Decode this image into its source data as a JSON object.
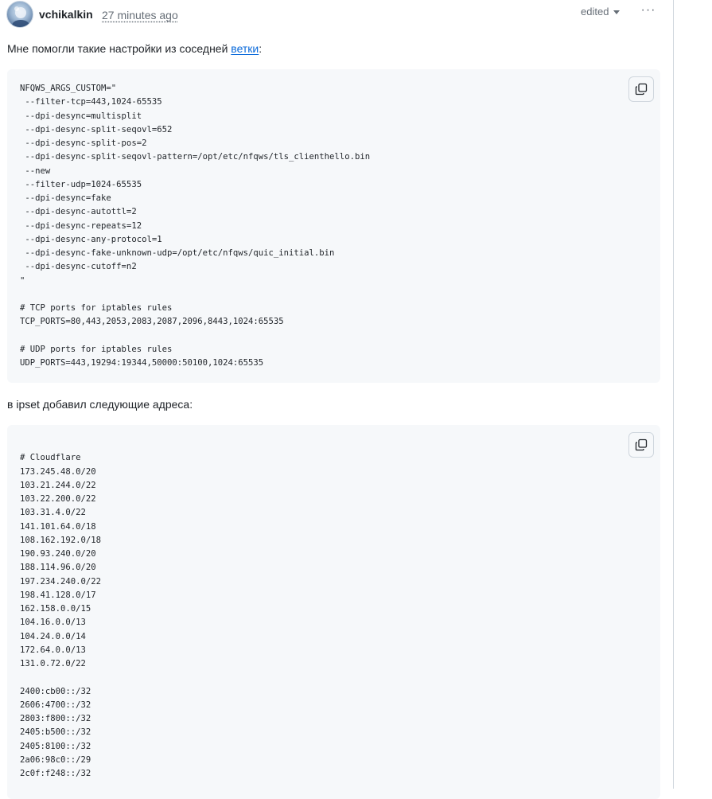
{
  "comment": {
    "author": "vchikalkin",
    "timestamp": "27 minutes ago",
    "edited_label": "edited",
    "menu_label": "···"
  },
  "body": {
    "intro_text": "Мне помогли такие настройки из соседней ",
    "intro_link": "ветки",
    "intro_suffix": ":",
    "second_text": "в ipset добавил следующие адреса:"
  },
  "code_blocks": [
    {
      "lines": [
        "NFQWS_ARGS_CUSTOM=\"",
        " --filter-tcp=443,1024-65535",
        " --dpi-desync=multisplit",
        " --dpi-desync-split-seqovl=652",
        " --dpi-desync-split-pos=2",
        " --dpi-desync-split-seqovl-pattern=/opt/etc/nfqws/tls_clienthello.bin",
        " --new",
        " --filter-udp=1024-65535",
        " --dpi-desync=fake",
        " --dpi-desync-autottl=2",
        " --dpi-desync-repeats=12",
        " --dpi-desync-any-protocol=1",
        " --dpi-desync-fake-unknown-udp=/opt/etc/nfqws/quic_initial.bin",
        " --dpi-desync-cutoff=n2",
        "\"",
        "",
        "# TCP ports for iptables rules",
        "TCP_PORTS=80,443,2053,2083,2087,2096,8443,1024:65535",
        "",
        "# UDP ports for iptables rules",
        "UDP_PORTS=443,19294:19344,50000:50100,1024:65535"
      ],
      "copy_icon": "copy-icon"
    },
    {
      "lines": [
        "",
        "# Cloudflare",
        "173.245.48.0/20",
        "103.21.244.0/22",
        "103.22.200.0/22",
        "103.31.4.0/22",
        "141.101.64.0/18",
        "108.162.192.0/18",
        "190.93.240.0/20",
        "188.114.96.0/20",
        "197.234.240.0/22",
        "198.41.128.0/17",
        "162.158.0.0/15",
        "104.16.0.0/13",
        "104.24.0.0/14",
        "172.64.0.0/13",
        "131.0.72.0/22",
        "",
        "2400:cb00::/32",
        "2606:4700::/32",
        "2803:f800::/32",
        "2405:b500::/32",
        "2405:8100::/32",
        "2a06:98c0::/29",
        "2c0f:f248::/32"
      ],
      "copy_icon": "copy-icon"
    }
  ],
  "colors": {
    "link": "#0969da",
    "muted": "#656d76",
    "code_bg": "#f6f8fa",
    "border": "#d0d7de"
  }
}
